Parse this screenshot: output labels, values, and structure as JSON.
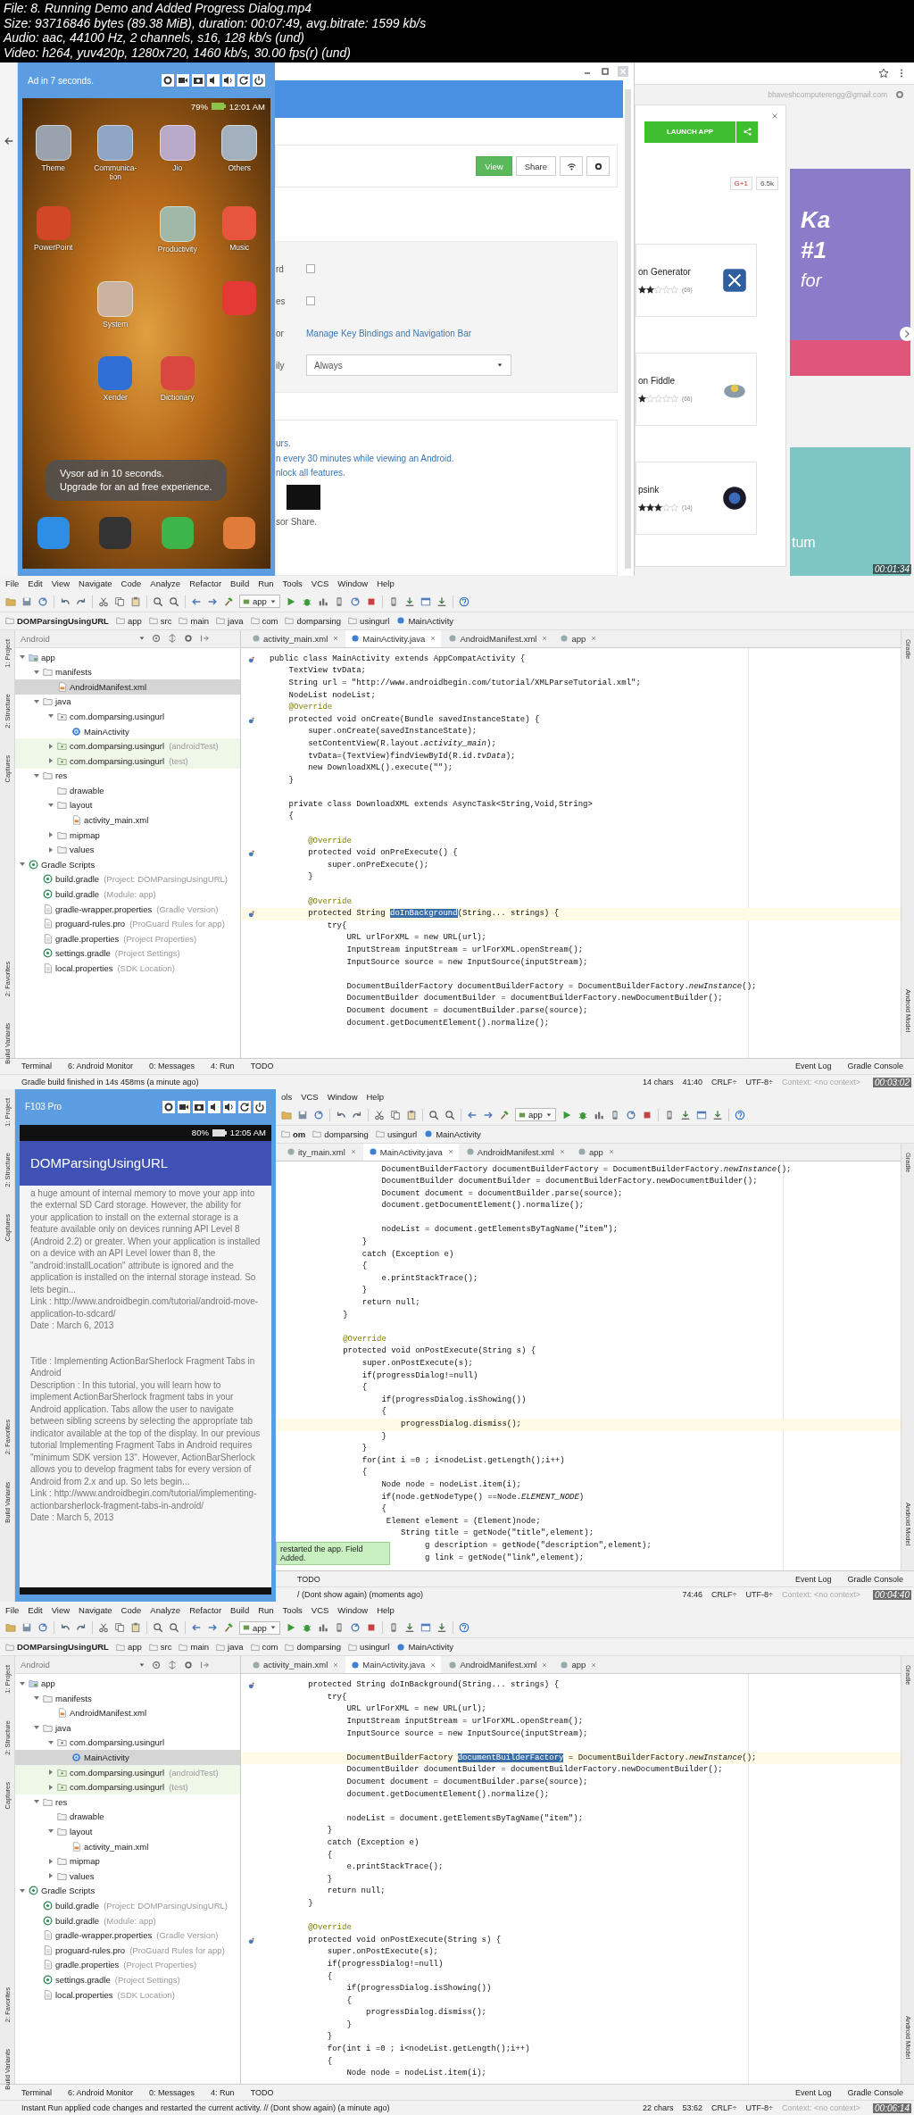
{
  "header": {
    "lines": [
      "File: 8. Running Demo and Added Progress Dialog.mp4",
      "Size: 93716846 bytes (89.38 MiB), duration: 00:07:49, avg.bitrate: 1599 kb/s",
      "Audio: aac, 44100 Hz, 2 channels, s16, 128 kb/s (und)",
      "Video: h264, yuv420p, 1280x720, 1460 kb/s, 30.00 fps(r) (und)"
    ]
  },
  "frames": [
    {
      "kind": "vysor-browser",
      "timestamp": "00:01:34",
      "vysor": {
        "title": "Ad in 7 seconds.",
        "battery": "79%",
        "time": "12:01 AM",
        "app_rows": [
          [
            {
              "kind": "folder",
              "label": "Theme",
              "color": "#9aa3ad"
            },
            {
              "kind": "folder",
              "label": "Communica-tion",
              "color": "#8fa5c4"
            },
            {
              "kind": "folder",
              "label": "Jio",
              "color": "#b8a9c9"
            },
            {
              "kind": "folder",
              "label": "Others",
              "color": "#a3b0bd"
            }
          ],
          [
            {
              "kind": "app",
              "label": "PowerPoint",
              "color": "#d24726"
            },
            {
              "kind": "empty"
            },
            {
              "kind": "folder",
              "label": "Productivity",
              "color": "#9fb8a8"
            },
            {
              "kind": "app",
              "label": "Music",
              "color": "#e8553f"
            }
          ],
          [
            {
              "kind": "empty"
            },
            {
              "kind": "folder",
              "label": "System",
              "color": "#c9b2a0"
            },
            {
              "kind": "empty"
            },
            {
              "kind": "app",
              "color": "#e53935"
            }
          ],
          [
            {
              "kind": "empty"
            },
            {
              "kind": "app",
              "label": "Xender",
              "color": "#2f6fd6"
            },
            {
              "kind": "app",
              "label": "Dictionary",
              "color": "#d9473f"
            },
            {
              "kind": "empty"
            }
          ]
        ],
        "dock": [
          {
            "color": "#2e8ee6"
          },
          {
            "color": "#333333"
          },
          {
            "color": "#3cb54a"
          },
          {
            "color": "#e07b39"
          }
        ],
        "toast": [
          "Vysor ad in 10 seconds.",
          "Upgrade for an ad free experience."
        ]
      },
      "browser": {
        "buttons": [
          {
            "kind": "primary",
            "label": "View"
          },
          {
            "kind": "default",
            "label": "Share"
          }
        ],
        "settings": [
          {
            "kind": "checkbox",
            "label": "rd",
            "checked": false
          },
          {
            "kind": "checkbox",
            "label": "es",
            "checked": false
          },
          {
            "kind": "link",
            "label": "or",
            "value": "Manage Key Bindings and Navigation Bar"
          },
          {
            "kind": "select",
            "label": "ily",
            "value": "Always"
          }
        ],
        "notes": [
          "urs.",
          "n every 30 minutes while viewing an Android.",
          "nlock all features."
        ],
        "footer": "sor Share."
      },
      "store": {
        "email": "bhaveshcomputerengg@gmail.com",
        "launch": "LAUNCH APP",
        "gplus": "G+1",
        "count": "6.5k",
        "apps": [
          {
            "name": "on Generator",
            "stars": 2,
            "reviews": "(69)"
          },
          {
            "name": "on Fiddle",
            "stars": 1,
            "reviews": "(66)"
          },
          {
            "name": "psink",
            "stars": 3,
            "reviews": "(14)"
          }
        ],
        "banner": [
          "Ka",
          "#1",
          "for"
        ],
        "promo": "tum"
      }
    },
    {
      "kind": "ide",
      "timestamp": "00:03:02",
      "menu": [
        "File",
        "Edit",
        "View",
        "Navigate",
        "Code",
        "Analyze",
        "Refactor",
        "Build",
        "Run",
        "Tools",
        "VCS",
        "Window",
        "Help"
      ],
      "run_config": "app",
      "breadcrumbs": [
        "DOMParsingUsingURL",
        "app",
        "src",
        "main",
        "java",
        "com",
        "domparsing",
        "usingurl",
        "MainActivity"
      ],
      "project_view": "Android",
      "tabs": [
        {
          "label": "activity_main.xml",
          "selected": false
        },
        {
          "label": "MainActivity.java",
          "selected": true
        },
        {
          "label": "AndroidManifest.xml",
          "selected": false
        },
        {
          "label": "app",
          "selected": false
        }
      ],
      "tree": [
        {
          "label": "app",
          "kind": "module",
          "expanded": true,
          "selected": false,
          "children": [
            {
              "label": "manifests",
              "kind": "folder",
              "expanded": true,
              "selected": false,
              "children": [
                {
                  "label": "AndroidManifest.xml",
                  "kind": "xml",
                  "selected": true
                }
              ]
            },
            {
              "label": "java",
              "kind": "folder",
              "expanded": true,
              "selected": false,
              "children": [
                {
                  "label": "com.domparsing.usingurl",
                  "kind": "package",
                  "expanded": true,
                  "selected": false,
                  "children": [
                    {
                      "label": "MainActivity",
                      "kind": "class",
                      "selected": false
                    }
                  ]
                },
                {
                  "label": "com.domparsing.usingurl",
                  "note": "(androidTest)",
                  "kind": "test",
                  "expanded": false,
                  "selected": false
                },
                {
                  "label": "com.domparsing.usingurl",
                  "note": "(test)",
                  "kind": "test",
                  "expanded": false,
                  "selected": false
                }
              ]
            },
            {
              "label": "res",
              "kind": "folder",
              "expanded": true,
              "selected": false,
              "children": [
                {
                  "label": "drawable",
                  "kind": "folder",
                  "selected": false
                },
                {
                  "label": "layout",
                  "kind": "folder",
                  "expanded": true,
                  "selected": false,
                  "children": [
                    {
                      "label": "activity_main.xml",
                      "kind": "xml",
                      "selected": false
                    }
                  ]
                },
                {
                  "label": "mipmap",
                  "kind": "folder",
                  "expanded": false,
                  "selected": false
                },
                {
                  "label": "values",
                  "kind": "folder",
                  "expanded": false,
                  "selected": false
                }
              ]
            }
          ]
        },
        {
          "label": "Gradle Scripts",
          "kind": "gradle",
          "expanded": true,
          "selected": false,
          "children": [
            {
              "label": "build.gradle",
              "note": "(Project: DOMParsingUsingURL)",
              "kind": "gradle",
              "selected": false
            },
            {
              "label": "build.gradle",
              "note": "(Module: app)",
              "kind": "gradle",
              "selected": false
            },
            {
              "label": "gradle-wrapper.properties",
              "note": "(Gradle Version)",
              "kind": "file",
              "selected": false
            },
            {
              "label": "proguard-rules.pro",
              "note": "(ProGuard Rules for app)",
              "kind": "file",
              "selected": false
            },
            {
              "label": "gradle.properties",
              "note": "(Project Properties)",
              "kind": "file",
              "selected": false
            },
            {
              "label": "settings.gradle",
              "note": "(Project Settings)",
              "kind": "gradle",
              "selected": false
            },
            {
              "label": "local.properties",
              "note": "(SDK Location)",
              "kind": "file",
              "selected": false
            }
          ]
        }
      ],
      "code": [
        {
          "kind": "code",
          "code": "public class MainActivity extends AppCompatActivity {",
          "marker": true
        },
        {
          "kind": "code",
          "code": "    TextView tvData;"
        },
        {
          "kind": "code",
          "code": "    String url = \"http://www.androidbegin.com/tutorial/XMLParseTutorial.xml\";"
        },
        {
          "kind": "code",
          "code": "    NodeList nodeList;"
        },
        {
          "kind": "annotation",
          "code": "    @Override"
        },
        {
          "kind": "code",
          "code": "    protected void onCreate(Bundle savedInstanceState) {",
          "marker": true
        },
        {
          "kind": "code",
          "code": "        super.onCreate(savedInstanceState);"
        },
        {
          "kind": "code",
          "code": "        setContentView(R.layout.*activity_main*);"
        },
        {
          "kind": "code",
          "code": "        tvData=(TextView)findViewById(R.id.*tvData*);"
        },
        {
          "kind": "code",
          "code": "        new DownloadXML().execute(\"\");"
        },
        {
          "kind": "code",
          "code": "    }"
        },
        {
          "kind": "blank"
        },
        {
          "kind": "code",
          "code": "    private class DownloadXML extends AsyncTask<String,Void,String>"
        },
        {
          "kind": "code",
          "code": "    {"
        },
        {
          "kind": "blank"
        },
        {
          "kind": "annotation",
          "code": "        @Override"
        },
        {
          "kind": "code",
          "code": "        protected void onPreExecute() {",
          "marker": true
        },
        {
          "kind": "code",
          "code": "            super.onPreExecute();"
        },
        {
          "kind": "code",
          "code": "        }"
        },
        {
          "kind": "blank"
        },
        {
          "kind": "annotation",
          "code": "        @Override"
        },
        {
          "kind": "selection",
          "before": "        protected String ",
          "selected": "doInBackground",
          "after": "(String... strings) {",
          "current": true,
          "marker": true
        },
        {
          "kind": "code",
          "code": "            try{"
        },
        {
          "kind": "code",
          "code": "                URL urlForXML = new URL(url);"
        },
        {
          "kind": "code",
          "code": "                InputStream inputStream = urlForXML.openStream();"
        },
        {
          "kind": "code",
          "code": "                InputSource source = new InputSource(inputStream);"
        },
        {
          "kind": "blank"
        },
        {
          "kind": "code",
          "code": "                DocumentBuilderFactory documentBuilderFactory = DocumentBuilderFactory.*newInstance*();"
        },
        {
          "kind": "code",
          "code": "                DocumentBuilder documentBuilder = documentBuilderFactory.newDocumentBuilder();"
        },
        {
          "kind": "code",
          "code": "                Document document = documentBuilder.parse(source);"
        },
        {
          "kind": "code",
          "code": "                document.getDocumentElement().normalize();"
        }
      ],
      "side_left": [
        "1: Project",
        "2: Structure",
        "Captures",
        "2: Favorites",
        "Build Variants"
      ],
      "side_right": [
        "Gradle",
        "Android Model"
      ],
      "tool_tabs": [
        "Terminal",
        "6: Android Monitor",
        "0: Messages",
        "4: Run",
        "TODO"
      ],
      "tool_tabs_right": [
        "Event Log",
        "Gradle Console"
      ],
      "status": "Gradle build finished in 14s 458ms (a minute ago)",
      "status_items": [
        "14 chars",
        "41:40",
        "CRLF÷",
        "UTF-8÷",
        "Context: <no context>"
      ]
    },
    {
      "kind": "ide-phone",
      "timestamp": "00:04:40",
      "phone": {
        "device": "F103 Pro",
        "time": "12:05 AM",
        "battery": "80%",
        "app_title": "DOMParsingUsingURL",
        "entries": [
          [
            "a huge amount of internal memory to move your app into the external SD Card storage. However, the ability for your application to install on the external storage is a feature available only on devices running API Level 8 (Android 2.2) or greater. When your application is installed on a device with an API Level lower than 8, the \"android:installLocation\" attribute is ignored and the application is installed on the internal storage instead. So lets begin...",
            "Link : http://www.androidbegin.com/tutorial/android-move-application-to-sdcard/",
            "Date : March 6, 2013"
          ],
          [
            "Title : Implementing ActionBarSherlock Fragment Tabs in Android",
            "Description : In this tutorial, you will learn how to implement ActionBarSherlock fragment tabs in your Android application. Tabs allow the user to navigate between sibling screens by selecting the appropriate tab indicator available at the top of the display. In our previous tutorial Implementing Fragment Tabs in Android requires \"minimum SDK version 13\". However, ActionBarSherlock allows you to develop fragment tabs for every version of Android from 2.x and up. So lets begin...",
            "Link : http://www.androidbegin.com/tutorial/implementing-actionbarsherlock-fragment-tabs-in-android/",
            "Date : March 5, 2013"
          ]
        ]
      },
      "menu": [
        "ols",
        "VCS",
        "Window",
        "Help"
      ],
      "run_config": "app",
      "breadcrumbs": [
        "om",
        "domparsing",
        "usingurl",
        "MainActivity"
      ],
      "tabs": [
        {
          "label": "ity_main.xml",
          "selected": false
        },
        {
          "label": "MainActivity.java",
          "selected": true
        },
        {
          "label": "AndroidManifest.xml",
          "selected": false
        },
        {
          "label": "app",
          "selected": false
        }
      ],
      "code": [
        {
          "kind": "code",
          "code": "                DocumentBuilderFactory documentBuilderFactory = DocumentBuilderFactory.*newInstance*();"
        },
        {
          "kind": "code",
          "code": "                DocumentBuilder documentBuilder = documentBuilderFactory.newDocumentBuilder();"
        },
        {
          "kind": "code",
          "code": "                Document document = documentBuilder.parse(source);"
        },
        {
          "kind": "code",
          "code": "                document.getDocumentElement().normalize();"
        },
        {
          "kind": "blank"
        },
        {
          "kind": "code",
          "code": "                nodeList = document.getElementsByTagName(\"item\");"
        },
        {
          "kind": "code",
          "code": "            }"
        },
        {
          "kind": "code",
          "code": "            catch (Exception e)"
        },
        {
          "kind": "code",
          "code": "            {"
        },
        {
          "kind": "code",
          "code": "                e.printStackTrace();"
        },
        {
          "kind": "code",
          "code": "            }"
        },
        {
          "kind": "code",
          "code": "            return null;"
        },
        {
          "kind": "code",
          "code": "        }"
        },
        {
          "kind": "blank"
        },
        {
          "kind": "annotation",
          "code": "        @Override"
        },
        {
          "kind": "code",
          "code": "        protected void onPostExecute(String s) {"
        },
        {
          "kind": "code",
          "code": "            super.onPostExecute(s);"
        },
        {
          "kind": "code",
          "code": "            if(progressDialog!=null)"
        },
        {
          "kind": "code",
          "code": "            {"
        },
        {
          "kind": "code",
          "code": "                if(progressDialog.isShowing())"
        },
        {
          "kind": "code",
          "code": "                {"
        },
        {
          "kind": "code",
          "code": "                    progressDialog.dismiss();",
          "current": true
        },
        {
          "kind": "code",
          "code": "                }"
        },
        {
          "kind": "code",
          "code": "            }"
        },
        {
          "kind": "code",
          "code": "            for(int i =0 ; i<nodeList.getLength();i++)"
        },
        {
          "kind": "code",
          "code": "            {"
        },
        {
          "kind": "code",
          "code": "                Node node = nodeList.item(i);"
        },
        {
          "kind": "code",
          "code": "                if(node.getNodeType() ==Node.*ELEMENT_NODE*)"
        },
        {
          "kind": "code",
          "code": "                {"
        },
        {
          "kind": "code",
          "code": "                 Element element = (Element)node;"
        },
        {
          "kind": "code",
          "code": "                    String title = getNode(\"title\",element);"
        },
        {
          "kind": "code",
          "code": "                         g description = getNode(\"description\",element);"
        },
        {
          "kind": "code",
          "code": "                         g link = getNode(\"link\",element);"
        }
      ],
      "toast": "restarted the app. Field Added.",
      "side_left": [
        "1: Project",
        "2: Structure",
        "Captures",
        "2: Favorites",
        "Build Variants"
      ],
      "side_right": [
        "Gradle",
        "Android Model"
      ],
      "tool_tabs": [
        "TODO"
      ],
      "tool_tabs_right": [
        "Event Log",
        "Gradle Console"
      ],
      "status": "/ (Dont show again) (moments ago)",
      "status_items": [
        "74:46",
        "CRLF÷",
        "UTF-8÷",
        "Context: <no context>"
      ]
    },
    {
      "kind": "ide",
      "timestamp": "00:06:14",
      "menu": [
        "File",
        "Edit",
        "View",
        "Navigate",
        "Code",
        "Analyze",
        "Refactor",
        "Build",
        "Run",
        "Tools",
        "VCS",
        "Window",
        "Help"
      ],
      "run_config": "app",
      "breadcrumbs": [
        "DOMParsingUsingURL",
        "app",
        "src",
        "main",
        "java",
        "com",
        "domparsing",
        "usingurl",
        "MainActivity"
      ],
      "project_view": "Android",
      "tabs": [
        {
          "label": "activity_main.xml",
          "selected": false
        },
        {
          "label": "MainActivity.java",
          "selected": true
        },
        {
          "label": "AndroidManifest.xml",
          "selected": false
        },
        {
          "label": "app",
          "selected": false
        }
      ],
      "tree": [
        {
          "label": "app",
          "kind": "module",
          "expanded": true,
          "selected": false,
          "children": [
            {
              "label": "manifests",
              "kind": "folder",
              "expanded": true,
              "selected": false,
              "children": [
                {
                  "label": "AndroidManifest.xml",
                  "kind": "xml",
                  "selected": false
                }
              ]
            },
            {
              "label": "java",
              "kind": "folder",
              "expanded": true,
              "selected": false,
              "children": [
                {
                  "label": "com.domparsing.usingurl",
                  "kind": "package",
                  "expanded": true,
                  "selected": false,
                  "children": [
                    {
                      "label": "MainActivity",
                      "kind": "class",
                      "selected": true
                    }
                  ]
                },
                {
                  "label": "com.domparsing.usingurl",
                  "note": "(androidTest)",
                  "kind": "test",
                  "expanded": false,
                  "selected": false
                },
                {
                  "label": "com.domparsing.usingurl",
                  "note": "(test)",
                  "kind": "test",
                  "expanded": false,
                  "selected": false
                }
              ]
            },
            {
              "label": "res",
              "kind": "folder",
              "expanded": true,
              "selected": false,
              "children": [
                {
                  "label": "drawable",
                  "kind": "folder",
                  "selected": false
                },
                {
                  "label": "layout",
                  "kind": "folder",
                  "expanded": true,
                  "selected": false,
                  "children": [
                    {
                      "label": "activity_main.xml",
                      "kind": "xml",
                      "selected": false
                    }
                  ]
                },
                {
                  "label": "mipmap",
                  "kind": "folder",
                  "expanded": false,
                  "selected": false
                },
                {
                  "label": "values",
                  "kind": "folder",
                  "expanded": false,
                  "selected": false
                }
              ]
            }
          ]
        },
        {
          "label": "Gradle Scripts",
          "kind": "gradle",
          "expanded": true,
          "selected": false,
          "children": [
            {
              "label": "build.gradle",
              "note": "(Project: DOMParsingUsingURL)",
              "kind": "gradle",
              "selected": false
            },
            {
              "label": "build.gradle",
              "note": "(Module: app)",
              "kind": "gradle",
              "selected": false
            },
            {
              "label": "gradle-wrapper.properties",
              "note": "(Gradle Version)",
              "kind": "file",
              "selected": false
            },
            {
              "label": "proguard-rules.pro",
              "note": "(ProGuard Rules for app)",
              "kind": "file",
              "selected": false
            },
            {
              "label": "gradle.properties",
              "note": "(Project Properties)",
              "kind": "file",
              "selected": false
            },
            {
              "label": "settings.gradle",
              "note": "(Project Settings)",
              "kind": "gradle",
              "selected": false
            },
            {
              "label": "local.properties",
              "note": "(SDK Location)",
              "kind": "file",
              "selected": false
            }
          ]
        }
      ],
      "code": [
        {
          "kind": "code",
          "code": "        protected String doInBackground(String... strings) {",
          "marker": true
        },
        {
          "kind": "code",
          "code": "            try{"
        },
        {
          "kind": "code",
          "code": "                URL urlForXML = new URL(url);"
        },
        {
          "kind": "code",
          "code": "                InputStream inputStream = urlForXML.openStream();"
        },
        {
          "kind": "code",
          "code": "                InputSource source = new InputSource(inputStream);"
        },
        {
          "kind": "blank"
        },
        {
          "kind": "selection",
          "before": "                DocumentBuilderFactory ",
          "selected": "documentBuilderFactory",
          "after": " = DocumentBuilderFactory.*newInstance*();",
          "current": true
        },
        {
          "kind": "code",
          "code": "                DocumentBuilder documentBuilder = documentBuilderFactory.newDocumentBuilder();"
        },
        {
          "kind": "code",
          "code": "                Document document = documentBuilder.parse(source);"
        },
        {
          "kind": "code",
          "code": "                document.getDocumentElement().normalize();"
        },
        {
          "kind": "blank"
        },
        {
          "kind": "code",
          "code": "                nodeList = document.getElementsByTagName(\"item\");"
        },
        {
          "kind": "code",
          "code": "            }"
        },
        {
          "kind": "code",
          "code": "            catch (Exception e)"
        },
        {
          "kind": "code",
          "code": "            {"
        },
        {
          "kind": "code",
          "code": "                e.printStackTrace();"
        },
        {
          "kind": "code",
          "code": "            }"
        },
        {
          "kind": "code",
          "code": "            return null;"
        },
        {
          "kind": "code",
          "code": "        }"
        },
        {
          "kind": "blank"
        },
        {
          "kind": "annotation",
          "code": "        @Override"
        },
        {
          "kind": "code",
          "code": "        protected void onPostExecute(String s) {",
          "marker": true
        },
        {
          "kind": "code",
          "code": "            super.onPostExecute(s);"
        },
        {
          "kind": "code",
          "code": "            if(progressDialog!=null)"
        },
        {
          "kind": "code",
          "code": "            {"
        },
        {
          "kind": "code",
          "code": "                if(progressDialog.isShowing())"
        },
        {
          "kind": "code",
          "code": "                {"
        },
        {
          "kind": "code",
          "code": "                    progressDialog.dismiss();"
        },
        {
          "kind": "code",
          "code": "                }"
        },
        {
          "kind": "code",
          "code": "            }"
        },
        {
          "kind": "code",
          "code": "            for(int i =0 ; i<nodeList.getLength();i++)"
        },
        {
          "kind": "code",
          "code": "            {"
        },
        {
          "kind": "code",
          "code": "                Node node = nodeList.item(i);"
        }
      ],
      "side_left": [
        "1: Project",
        "2: Structure",
        "Captures",
        "2: Favorites",
        "Build Variants"
      ],
      "side_right": [
        "Gradle",
        "Android Model"
      ],
      "tool_tabs": [
        "Terminal",
        "6: Android Monitor",
        "0: Messages",
        "4: Run",
        "TODO"
      ],
      "tool_tabs_right": [
        "Event Log",
        "Gradle Console"
      ],
      "status": "Instant Run applied code changes and restarted the current activity. // (Dont show again) (a minute ago)",
      "status_items": [
        "22 chars",
        "53:62",
        "CRLF÷",
        "UTF-8÷",
        "Context: <no context>"
      ]
    }
  ]
}
